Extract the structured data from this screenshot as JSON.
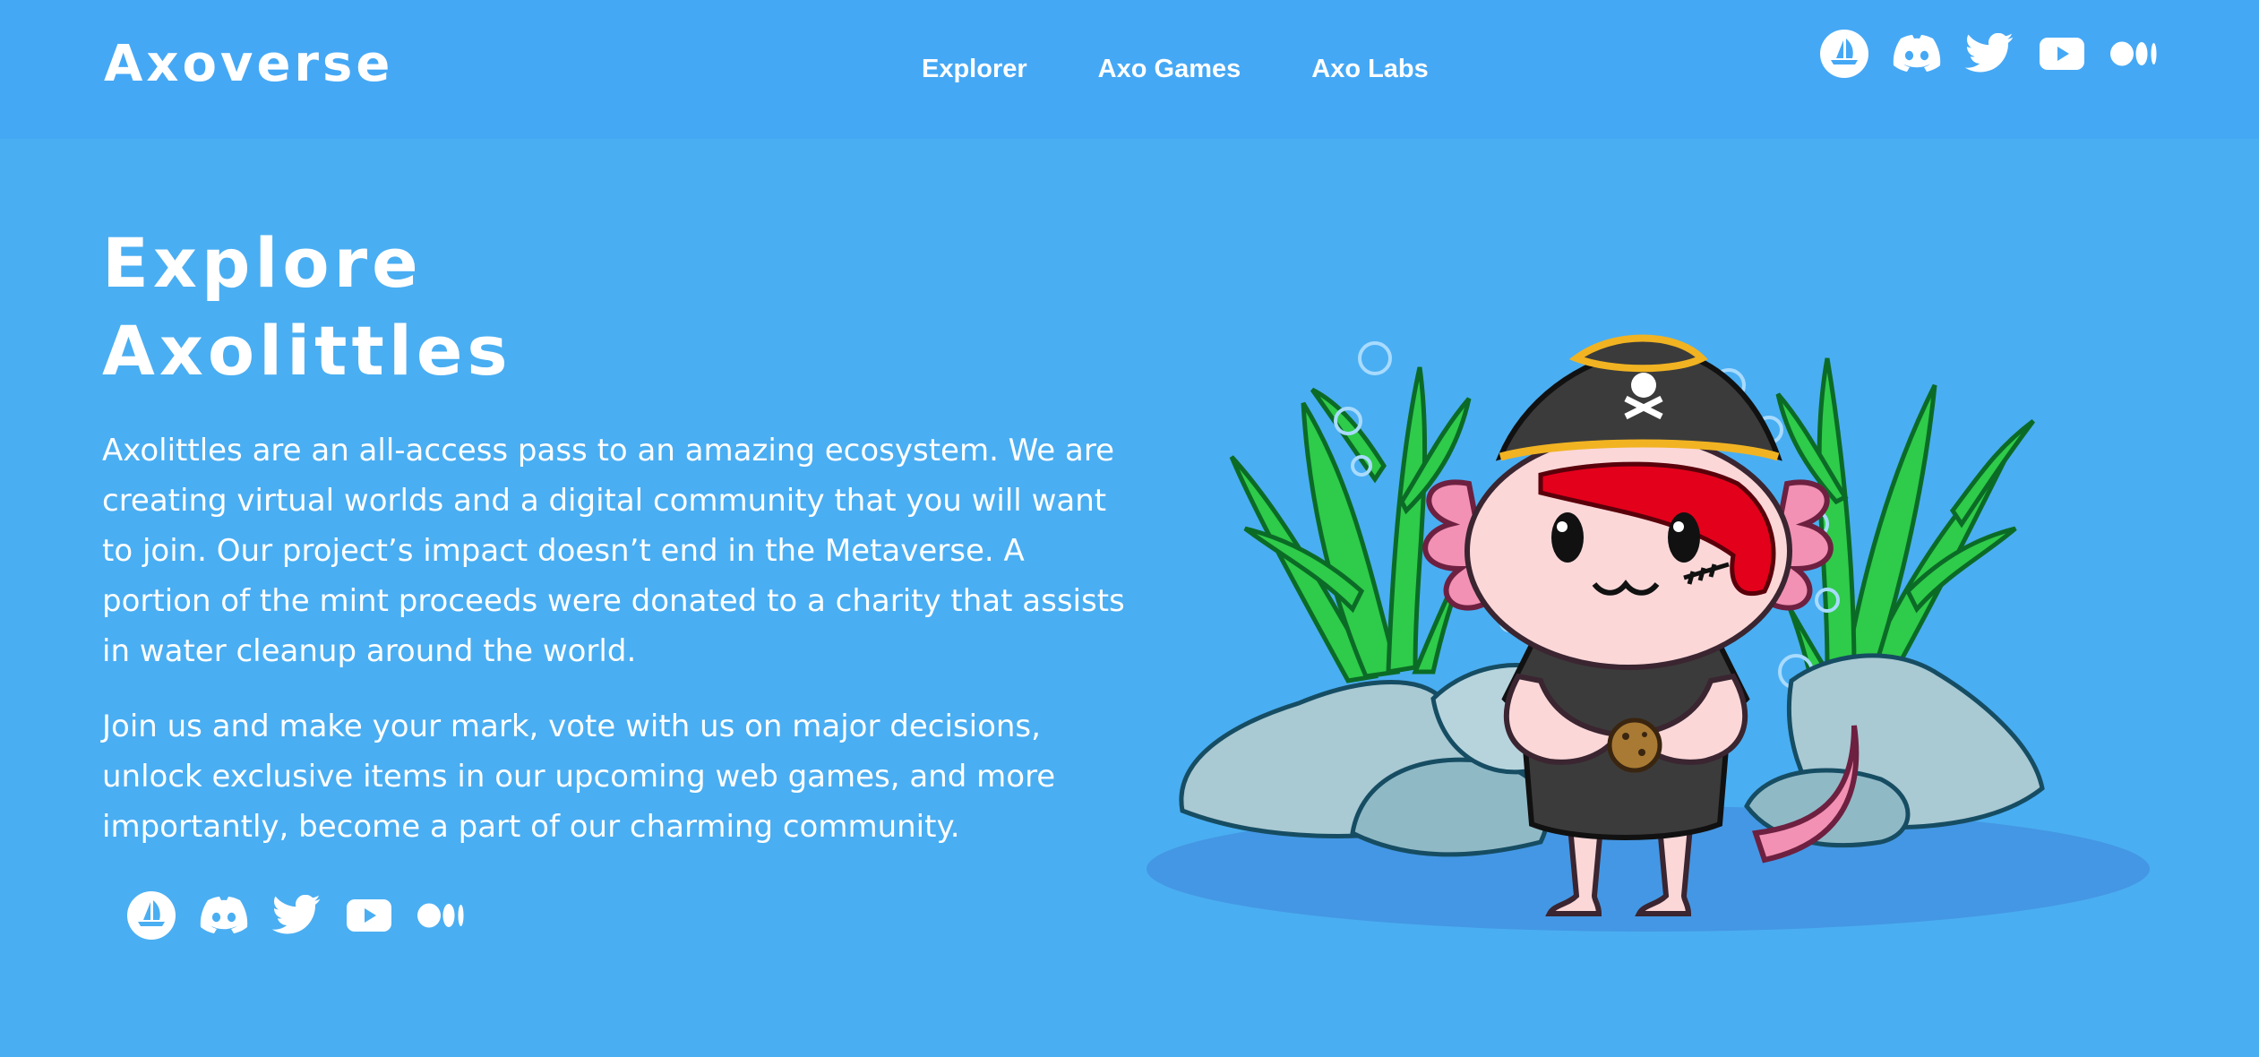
{
  "header": {
    "logo": "Axoverse",
    "nav": [
      {
        "label": "Explorer"
      },
      {
        "label": "Axo Games"
      },
      {
        "label": "Axo Labs"
      }
    ],
    "social_icons": [
      "opensea-icon",
      "discord-icon",
      "twitter-icon",
      "youtube-icon",
      "medium-icon"
    ]
  },
  "hero": {
    "title_line1": "Explore",
    "title_line2": "Axolittles",
    "paragraph1": "Axolittles are an all-access pass to an amazing ecosystem. We are creating virtual worlds and a digital community that you will want to join. Our project’s impact doesn’t end in the Metaverse. A portion of the mint proceeds were donated to a charity that assists in water cleanup around the world.",
    "paragraph2": "Join us and make your mark, vote with us on major decisions, unlock exclusive items in our upcoming web games, and more importantly, become a part of our charming community.",
    "social_icons": [
      "opensea-icon",
      "discord-icon",
      "twitter-icon",
      "youtube-icon",
      "medium-icon"
    ],
    "illustration": "axolotl-pirate-illustration"
  },
  "colors": {
    "background": "#4aaef2",
    "header": "#45a8f5",
    "text": "#ffffff",
    "seaweed": "#2fcb4a",
    "rock": "#a9c9d3",
    "axolotl_pink": "#fbd7d8",
    "gill_pink": "#f291b3",
    "hair_red": "#e3001b",
    "shirt": "#3b3b3b"
  }
}
